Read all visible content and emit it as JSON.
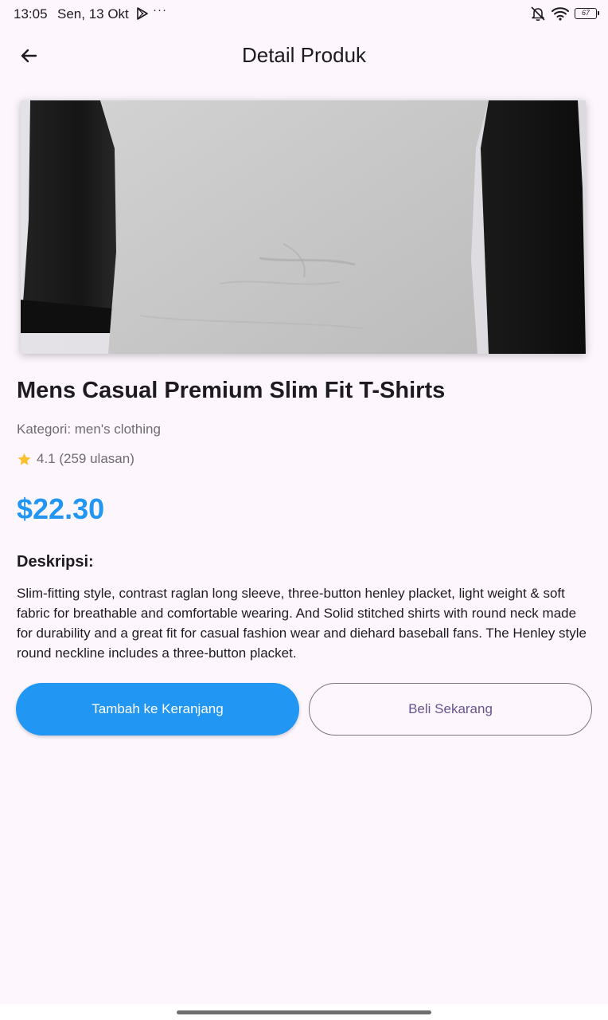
{
  "status_bar": {
    "time": "13:05",
    "date": "Sen, 13 Okt",
    "more": "···",
    "battery": "67",
    "icons": [
      "play-store-icon",
      "mute-bell-icon",
      "wifi-icon",
      "battery-icon"
    ]
  },
  "app_bar": {
    "title": "Detail Produk",
    "back_icon": "arrow-back-icon"
  },
  "product": {
    "title": "Mens Casual Premium Slim Fit T-Shirts",
    "category": "Kategori: men's clothing",
    "rating": "4.1 (259 ulasan)",
    "price": "$22.30",
    "description_heading": "Deskripsi:",
    "description": "Slim-fitting style, contrast raglan long sleeve, three-button henley placket, light weight & soft fabric for breathable and comfortable wearing. And Solid stitched shirts with round neck made for durability and a great fit for casual fashion wear and diehard baseball fans. The Henley style round neckline includes a three-button placket."
  },
  "actions": {
    "add_to_cart": "Tambah ke Keranjang",
    "buy_now": "Beli Sekarang"
  },
  "colors": {
    "background": "#fdf7fd",
    "accent": "#2196f3",
    "star": "#fbc02d",
    "outline_text": "#65558f"
  }
}
